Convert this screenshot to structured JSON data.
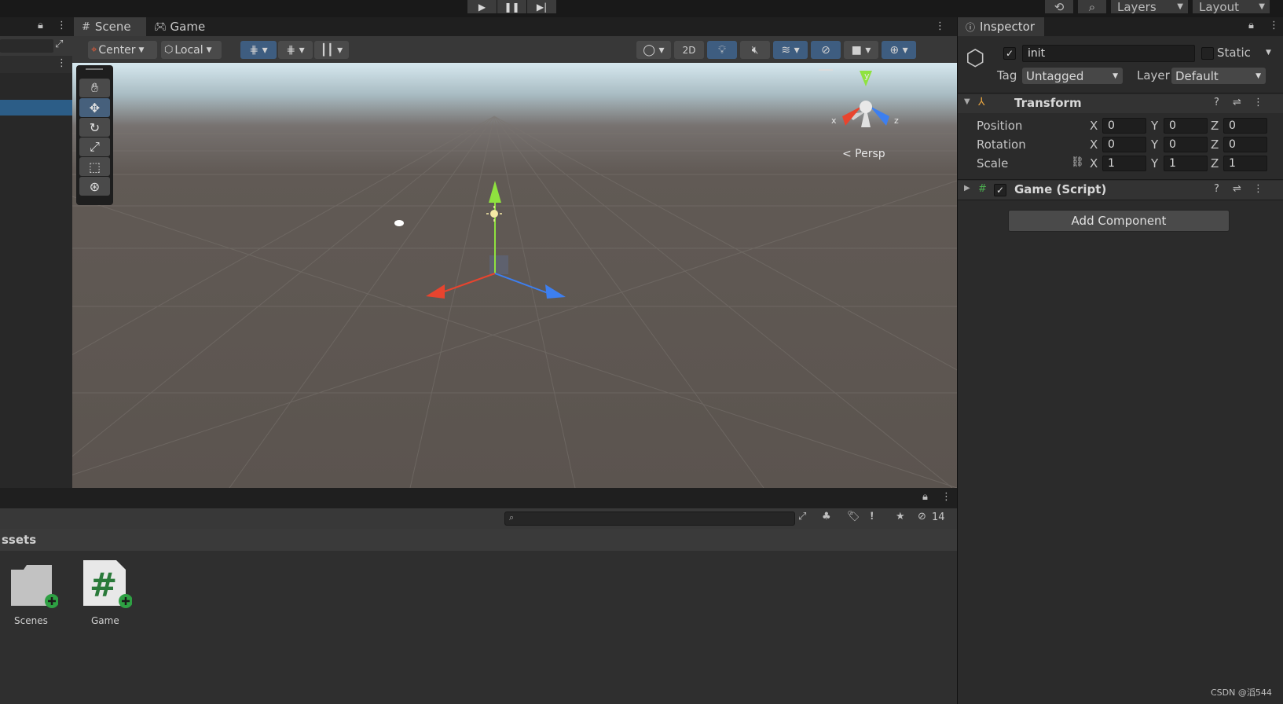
{
  "topbar": {
    "layers_label": "Layers",
    "layout_label": "Layout"
  },
  "scene_panel": {
    "tabs": [
      {
        "label": "Scene"
      },
      {
        "label": "Game"
      }
    ],
    "pivot_label": "Center",
    "space_label": "Local",
    "mode_2d_label": "2D",
    "view_label": "< Persp",
    "gizmo_axes": {
      "x": "x",
      "y": "y",
      "z": "z"
    }
  },
  "inspector": {
    "tab_label": "Inspector",
    "object_name": "init",
    "static_label": "Static",
    "tag_label": "Tag",
    "tag_value": "Untagged",
    "layer_label": "Layer",
    "layer_value": "Default",
    "transform": {
      "title": "Transform",
      "rows": [
        {
          "label": "Position",
          "x": "0",
          "y": "0",
          "z": "0"
        },
        {
          "label": "Rotation",
          "x": "0",
          "y": "0",
          "z": "0"
        },
        {
          "label": "Scale",
          "x": "1",
          "y": "1",
          "z": "1"
        }
      ],
      "axis_x": "X",
      "axis_y": "Y",
      "axis_z": "Z"
    },
    "script_component": "Game (Script)",
    "add_component_label": "Add Component"
  },
  "project": {
    "hidden_count": "14",
    "breadcrumb": "ssets",
    "items": [
      {
        "label": "Scenes",
        "icon": "folder-icon"
      },
      {
        "label": "Game",
        "icon": "csharp-script-icon"
      }
    ]
  },
  "watermark": "CSDN @滔544",
  "colors": {
    "accent": "#3e5d80",
    "selection": "#2c5d87",
    "axis_x": "#e8442e",
    "axis_y": "#8fe23f",
    "axis_z": "#3d7ff0"
  }
}
